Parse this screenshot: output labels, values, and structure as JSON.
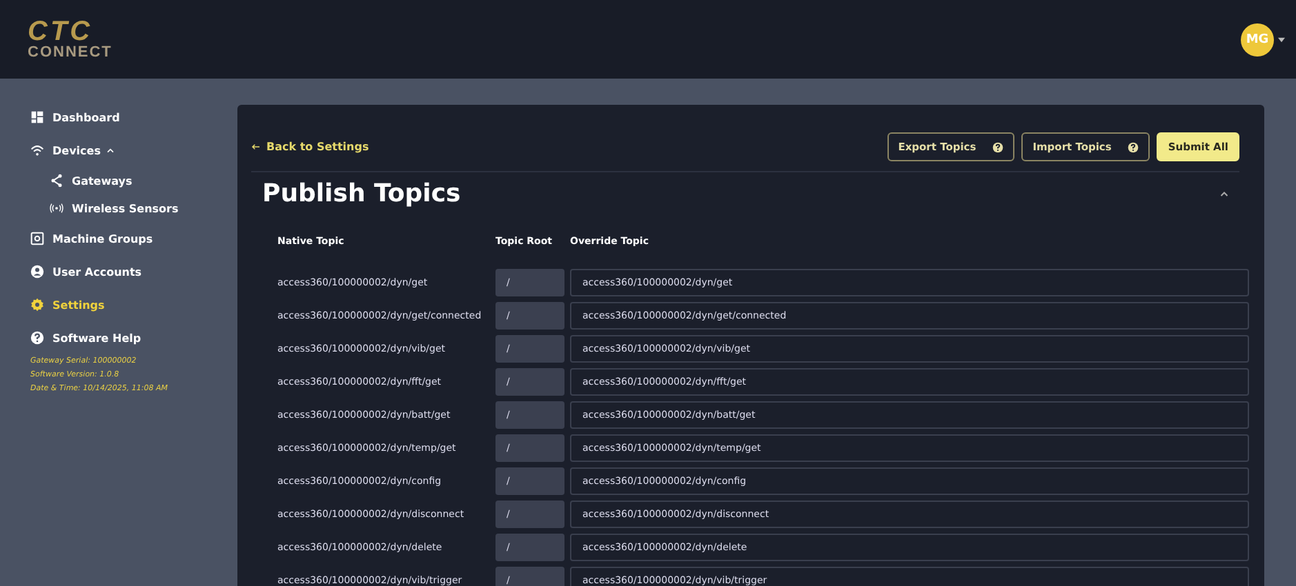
{
  "header": {
    "logo": {
      "top": "CTC",
      "bottom": "CONNECT"
    },
    "avatar": "MG"
  },
  "sidebar": {
    "items": [
      {
        "label": "Dashboard",
        "selected": false
      },
      {
        "label": "Devices",
        "selected": false,
        "expanded": true,
        "children": [
          {
            "label": "Gateways",
            "selected": false
          },
          {
            "label": "Wireless Sensors",
            "selected": false
          }
        ]
      },
      {
        "label": "Machine Groups",
        "selected": false
      },
      {
        "label": "User Accounts",
        "selected": false
      },
      {
        "label": "Settings",
        "selected": true
      },
      {
        "label": "Software Help",
        "selected": false
      }
    ],
    "info": [
      "Gateway Serial: 100000002",
      "Software Version: 1.0.8",
      "Date & Time: 10/14/2025, 11:08 AM"
    ]
  },
  "toolbar": {
    "back": "Back to Settings",
    "buttons": [
      {
        "label": "Export Topics",
        "kind": "help"
      },
      {
        "label": "Import Topics",
        "kind": "help"
      },
      {
        "label": "Submit All",
        "kind": "primary"
      }
    ]
  },
  "section": {
    "title": "Publish Topics",
    "expanded": true
  },
  "table": {
    "columns": [
      "Native Topic",
      "Topic Root",
      "Override Topic"
    ],
    "rows": [
      {
        "native": "access360/100000002/dyn/get",
        "root": "/",
        "override": "access360/100000002/dyn/get"
      },
      {
        "native": "access360/100000002/dyn/get/connected",
        "root": "/",
        "override": "access360/100000002/dyn/get/connected"
      },
      {
        "native": "access360/100000002/dyn/vib/get",
        "root": "/",
        "override": "access360/100000002/dyn/vib/get"
      },
      {
        "native": "access360/100000002/dyn/fft/get",
        "root": "/",
        "override": "access360/100000002/dyn/fft/get"
      },
      {
        "native": "access360/100000002/dyn/batt/get",
        "root": "/",
        "override": "access360/100000002/dyn/batt/get"
      },
      {
        "native": "access360/100000002/dyn/temp/get",
        "root": "/",
        "override": "access360/100000002/dyn/temp/get"
      },
      {
        "native": "access360/100000002/dyn/config",
        "root": "/",
        "override": "access360/100000002/dyn/config"
      },
      {
        "native": "access360/100000002/dyn/disconnect",
        "root": "/",
        "override": "access360/100000002/dyn/disconnect"
      },
      {
        "native": "access360/100000002/dyn/delete",
        "root": "/",
        "override": "access360/100000002/dyn/delete"
      },
      {
        "native": "access360/100000002/dyn/vib/trigger",
        "root": "/",
        "override": "access360/100000002/dyn/vib/trigger"
      }
    ]
  }
}
